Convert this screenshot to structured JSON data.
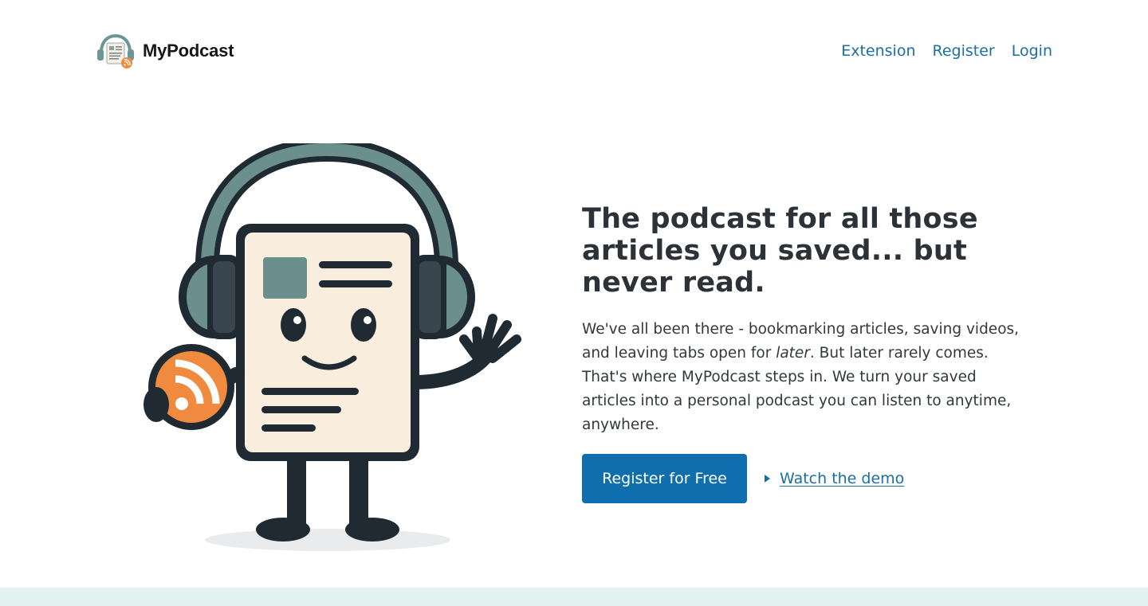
{
  "brand": {
    "name": "MyPodcast",
    "logo_icon": "podcast-logo-icon"
  },
  "nav": {
    "items": [
      {
        "label": "Extension"
      },
      {
        "label": "Register"
      },
      {
        "label": "Login"
      }
    ]
  },
  "hero": {
    "illustration_icon": "podcast-mascot-illustration",
    "title": "The podcast for all those articles you saved... but never read.",
    "body_before": "We've all been there - bookmarking articles, saving videos, and leaving tabs open for ",
    "body_emphasis": "later",
    "body_after": ". But later rarely comes. That's where MyPodcast steps in. We turn your saved articles into a personal podcast you can listen to anytime, anywhere.",
    "cta_label": "Register for Free",
    "demo_label": "Watch the demo",
    "demo_icon": "play-icon"
  },
  "colors": {
    "link": "#1b6fa3",
    "cta_background": "#0f6fae",
    "heading": "#2d3238",
    "footer_band": "#e4f2ef",
    "rss_orange": "#ef8a3e",
    "headphone_teal": "#6b8f8d"
  }
}
